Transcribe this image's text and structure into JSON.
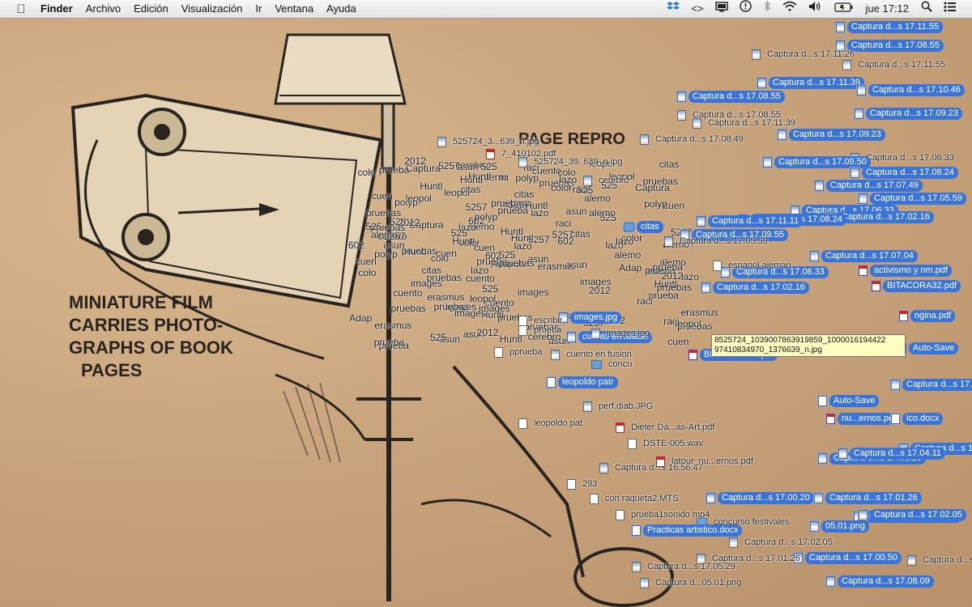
{
  "menubar": {
    "app_name": "Finder",
    "menus": [
      "Archivo",
      "Edición",
      "Visualización",
      "Ir",
      "Ventana",
      "Ayuda"
    ],
    "status_icons": [
      "dropbox-icon",
      "code-icon",
      "display-icon",
      "alert-icon",
      "bluetooth-icon",
      "wifi-icon",
      "volume-icon",
      "battery-icon"
    ],
    "clock": "jue 17:12"
  },
  "desktop": {
    "illustration_captions": [
      "MINIATURE FILM",
      "CARRIES PHOTO-",
      "GRAPHS OF BOOK",
      "PAGES"
    ],
    "illustration_sign": "PAGE REPRO",
    "tooltip": "8525724_1039007863919859_1000016194422 97410834970_1376639_n.jpg",
    "icons": [
      {
        "label": "Captura d...s 17.11.55",
        "type": "img",
        "sel": true
      },
      {
        "label": "Captura d...s 17.08.55",
        "type": "img",
        "sel": true
      },
      {
        "label": "Captura d...s 17.11.26",
        "type": "img",
        "sel": false
      },
      {
        "label": "Captura d...s 17.11.55",
        "type": "img",
        "sel": false
      },
      {
        "label": "Captura d...s 17.11.39",
        "type": "img",
        "sel": true
      },
      {
        "label": "Captura d...s 17.10.46",
        "type": "img",
        "sel": true
      },
      {
        "label": "Captura d...s 17.08.55",
        "type": "img",
        "sel": true
      },
      {
        "label": "Captura d...s 17.09.23",
        "type": "img",
        "sel": true
      },
      {
        "label": "Captura d...s 17.08.55",
        "type": "img",
        "sel": false
      },
      {
        "label": "Captura d...s 17.09.23",
        "type": "img",
        "sel": true
      },
      {
        "label": "Captura d...s 17.06.33",
        "type": "img",
        "sel": false
      },
      {
        "label": "Captura d...s 17.09.50",
        "type": "img",
        "sel": true
      },
      {
        "label": "Captura d...s 17.08.24",
        "type": "img",
        "sel": true
      },
      {
        "label": "Captura d...s 17.07.49",
        "type": "img",
        "sel": true
      },
      {
        "label": "Captura d...s 17.05.59",
        "type": "img",
        "sel": true
      },
      {
        "label": "Captura d...s 17.06.33",
        "type": "img",
        "sel": true
      },
      {
        "label": "Captura d...s 17.02.16",
        "type": "img",
        "sel": true
      },
      {
        "label": "Captura d...s 17.08.24",
        "type": "img",
        "sel": true
      },
      {
        "label": "Captura d...s 17.07.04",
        "type": "img",
        "sel": true
      },
      {
        "label": "activismo y nm.pdf",
        "type": "pdf",
        "sel": true
      },
      {
        "label": "Captura d...s 17.06.33",
        "type": "img",
        "sel": true
      },
      {
        "label": "BITACORA32.pdf",
        "type": "pdf",
        "sel": true
      },
      {
        "label": "Captura d...s 17.02.16",
        "type": "img",
        "sel": true
      },
      {
        "label": "ngina.pdf",
        "type": "pdf",
        "sel": true
      },
      {
        "label": "images.jpg",
        "type": "img",
        "sel": true
      },
      {
        "label": "cuento en fusion",
        "type": "img",
        "sel": true
      },
      {
        "label": "Auto-Save",
        "type": "doc",
        "sel": true
      },
      {
        "label": "BITACORA32.pdf",
        "type": "pdf",
        "sel": true
      },
      {
        "label": "Captura d...s 17.02.16",
        "type": "img",
        "sel": true
      },
      {
        "label": "nu...ernos.pdf",
        "type": "pdf",
        "sel": true
      },
      {
        "label": "Auto-Save",
        "type": "doc",
        "sel": true
      },
      {
        "label": "ico.docx",
        "type": "doc",
        "sel": true
      },
      {
        "label": "Captura d...s 17.01.26",
        "type": "img",
        "sel": true
      },
      {
        "label": "Captura d...s 17.00.20",
        "type": "img",
        "sel": true
      },
      {
        "label": "Captura d...s 17.04.11",
        "type": "img",
        "sel": true
      },
      {
        "label": "Captura d...s 17.00.20",
        "type": "img",
        "sel": true
      },
      {
        "label": "Captura d...s 17.01.26",
        "type": "img",
        "sel": true
      },
      {
        "label": "Captura d...s 17.00.50",
        "type": "img",
        "sel": true
      },
      {
        "label": "Captura d...s 17.02.05",
        "type": "img",
        "sel": true
      },
      {
        "label": "05.01.png",
        "type": "img",
        "sel": true
      },
      {
        "label": "Captura d...s 17.02.05",
        "type": "img",
        "sel": false
      },
      {
        "label": "Captura d...s 17.00.50",
        "type": "img",
        "sel": true
      },
      {
        "label": "Captura d...s 17.08.09",
        "type": "img",
        "sel": true
      },
      {
        "label": "Captura d...s 17.08.09",
        "type": "img",
        "sel": false
      },
      {
        "label": "Captura d...s 17.01.26",
        "type": "img",
        "sel": false
      },
      {
        "label": "Captura d...s 17.05.29",
        "type": "img",
        "sel": false
      },
      {
        "label": "Captura d...05.01.png",
        "type": "img",
        "sel": false
      },
      {
        "label": "concurso festivales",
        "type": "fold",
        "sel": false
      },
      {
        "label": "Practicas artistico.docx",
        "type": "doc",
        "sel": true
      },
      {
        "label": "con raqueta2.MTS",
        "type": "doc",
        "sel": false
      },
      {
        "label": "prueba1sonido mp4",
        "type": "doc",
        "sel": false
      },
      {
        "label": "perf.diab.JPG",
        "type": "img",
        "sel": false
      },
      {
        "label": "leopoldo pat",
        "type": "doc",
        "sel": false
      },
      {
        "label": "Captura d...s 16.56.47",
        "type": "img",
        "sel": false
      },
      {
        "label": "293",
        "type": "doc",
        "sel": false
      },
      {
        "label": "leopoldo patr",
        "type": "doc",
        "sel": true
      },
      {
        "label": "concu",
        "type": "fold",
        "sel": false
      },
      {
        "label": "pprueba",
        "type": "doc",
        "sel": false
      },
      {
        "label": "escribir",
        "type": "doc",
        "sel": false
      },
      {
        "label": "images.jpg",
        "type": "img",
        "sel": false
      },
      {
        "label": "prueba",
        "type": "doc",
        "sel": false
      },
      {
        "label": "cuento en fusion",
        "type": "img",
        "sel": false
      },
      {
        "label": "525724_3...639_n.jpg",
        "type": "img",
        "sel": false
      },
      {
        "label": "7_410102.pdf",
        "type": "pdf",
        "sel": false
      },
      {
        "label": "525724_39..639_n.jpg",
        "type": "img",
        "sel": false
      },
      {
        "label": "Captura d...s 17.08.49",
        "type": "img",
        "sel": false
      },
      {
        "label": "Captura d...s 17.11.39",
        "type": "img",
        "sel": false
      },
      {
        "label": "Captura d...s 17.09.55",
        "type": "img",
        "sel": true
      },
      {
        "label": "citas",
        "type": "fold",
        "sel": true
      },
      {
        "label": "cerebro",
        "type": "img",
        "sel": false
      },
      {
        "label": "espanol aleman",
        "type": "doc",
        "sel": false
      },
      {
        "label": "Captura d...s 17.11.11",
        "type": "img",
        "sel": true
      },
      {
        "label": "Captura d...s 17.05.59",
        "type": "img",
        "sel": false
      },
      {
        "label": "Dieter Da...as-Art.pdf",
        "type": "pdf",
        "sel": false
      },
      {
        "label": "DSTE-005.wav",
        "type": "doc",
        "sel": false
      },
      {
        "label": "latour_nu...ernos.pdf",
        "type": "pdf",
        "sel": false
      }
    ],
    "noise_words": [
      "lazo",
      "cuen",
      "Huntl",
      "2012",
      "Adap",
      "525",
      "602",
      "colo",
      "erasmus",
      "images",
      "prueba",
      "pruebas",
      "cerebro",
      "citas",
      "cuento",
      "polyp",
      "leopol",
      "asun",
      "alemo",
      "Captura",
      "mi",
      "5257",
      "color",
      "raci"
    ]
  }
}
